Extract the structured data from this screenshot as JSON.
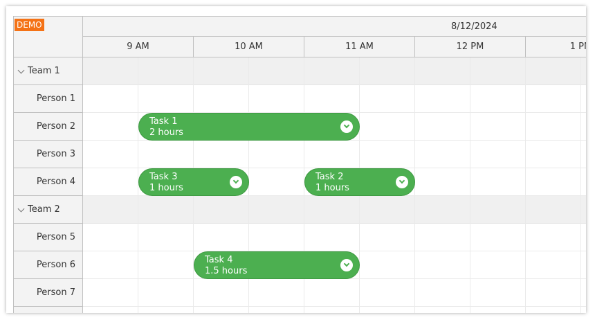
{
  "demo_badge": "DEMO",
  "header": {
    "date": "8/12/2024",
    "hours": [
      "9 AM",
      "10 AM",
      "11 AM",
      "12 PM",
      "1 PM"
    ]
  },
  "rows": [
    {
      "type": "group",
      "label": "Team 1"
    },
    {
      "type": "person",
      "label": "Person 1"
    },
    {
      "type": "person",
      "label": "Person 2"
    },
    {
      "type": "person",
      "label": "Person 3"
    },
    {
      "type": "person",
      "label": "Person 4"
    },
    {
      "type": "group",
      "label": "Team 2"
    },
    {
      "type": "person",
      "label": "Person 5"
    },
    {
      "type": "person",
      "label": "Person 6"
    },
    {
      "type": "person",
      "label": "Person 7"
    }
  ],
  "events": [
    {
      "title": "Task 1",
      "duration": "2 hours",
      "row": "Person 2"
    },
    {
      "title": "Task 3",
      "duration": "1 hours",
      "row": "Person 4"
    },
    {
      "title": "Task 2",
      "duration": "1 hours",
      "row": "Person 4"
    },
    {
      "title": "Task 4",
      "duration": "1.5 hours",
      "row": "Person 6"
    }
  ],
  "colors": {
    "event": "#4caf50",
    "demo_badge": "#f47216",
    "header_bg": "#f3f3f3",
    "group_row_bg": "#f0f0f0"
  }
}
